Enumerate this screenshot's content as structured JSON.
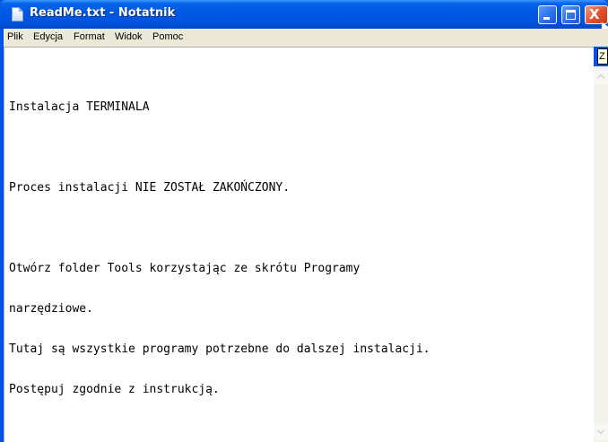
{
  "window": {
    "title": "ReadMe.txt - Notatnik",
    "icon": "notepad-icon",
    "controls": {
      "minimize_icon": "minimize-icon",
      "maximize_icon": "maximize-icon",
      "close_icon": "close-icon",
      "close_glyph": "X"
    }
  },
  "menu": {
    "items": [
      "Plik",
      "Edycja",
      "Format",
      "Widok",
      "Pomoc"
    ]
  },
  "tooltip": {
    "text": "Z"
  },
  "document": {
    "lines": [
      "Instalacja TERMINALA",
      "",
      "Proces instalacji NIE ZOSTAŁ ZAKOŃCZONY.",
      "",
      "Otwórz folder Tools korzystając ze skrótu Programy",
      "narzędziowe.",
      "Tutaj są wszystkie programy potrzebne do dalszej instalacji.",
      "Postępuj zgodnie z instrukcją."
    ]
  },
  "colors": {
    "titlebar": "#0058e6",
    "close_button": "#e0502a",
    "menubar": "#ece9d8",
    "editor_background": "#ffffff"
  }
}
